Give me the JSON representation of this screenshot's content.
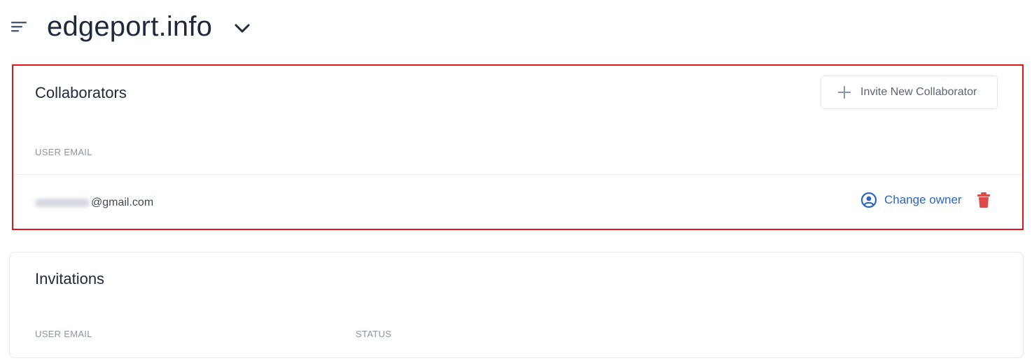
{
  "header": {
    "site_name": "edgeport.info"
  },
  "collaborators": {
    "title": "Collaborators",
    "invite_button_label": "Invite New Collaborator",
    "columns": {
      "email": "USER EMAIL"
    },
    "rows": [
      {
        "email_visible": "@gmail.com",
        "change_owner_label": "Change owner"
      }
    ]
  },
  "invitations": {
    "title": "Invitations",
    "columns": {
      "email": "USER EMAIL",
      "status": "STATUS"
    }
  },
  "colors": {
    "accent": "#2d64c8",
    "danger": "#dc4a4a",
    "highlight_border": "#e3151a"
  },
  "icons": {
    "menu": "menu-lines-icon",
    "chevron": "chevron-down-icon",
    "plus": "plus-icon",
    "user_circle": "user-circle-icon",
    "trash": "trash-icon"
  }
}
